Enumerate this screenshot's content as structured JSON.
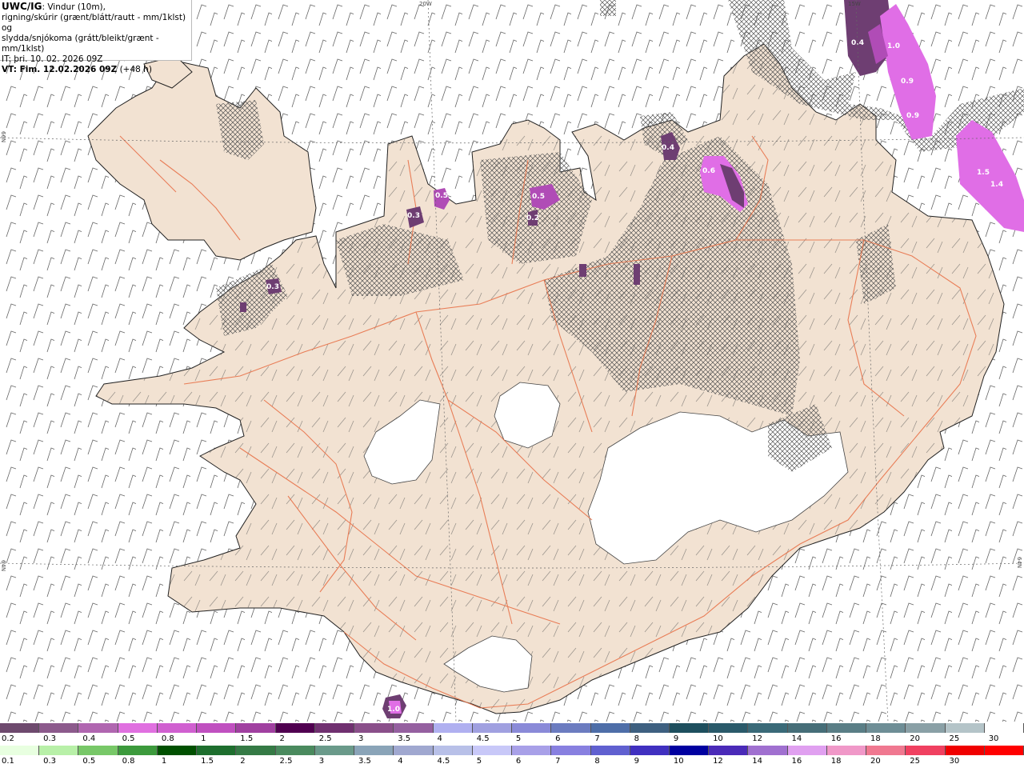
{
  "info": {
    "model": "UWC/IG",
    "line1": ": Vindur (10m),",
    "line2": "rigning/skúrir (grænt/blátt/rautt - mm/1klst) og",
    "line3": "slydda/snjókoma (grátt/bleikt/grænt - mm/1klst)",
    "line4": "IT: þri. 10. 02. 2026 09Z",
    "line5_bold": "VT: Fim. 12.02.2026 09Z",
    "line5_rest": " (+48 h)"
  },
  "grid_labels": {
    "top_20w": "20W",
    "top_15w": "15W",
    "left_66n": "66N",
    "left_64n": "64N",
    "right_64n": "64N"
  },
  "precip_labels": [
    "0.4",
    "1.0",
    "0.9",
    "0.9",
    "1.5",
    "1.4",
    "0.4",
    "0.6",
    "0.5",
    "0.3",
    "0.5",
    "0.2",
    "0.3",
    "1.0"
  ],
  "legend_snow": {
    "labels": [
      "0.2",
      "0.3",
      "0.4",
      "0.5",
      "0.8",
      "1",
      "1.5",
      "2",
      "2.5",
      "3",
      "3.5",
      "4",
      "4.5",
      "5",
      "6",
      "7",
      "8",
      "9",
      "10",
      "12",
      "14",
      "16",
      "18",
      "20",
      "25",
      "30"
    ],
    "colors": [
      "#6e4a6e",
      "#8c5a8c",
      "#b066b0",
      "#e070e0",
      "#d060d0",
      "#c050c0",
      "#a040a0",
      "#500050",
      "#703070",
      "#8a4f8a",
      "#9560a0",
      "#b0b0f0",
      "#a0a0e0",
      "#8a8ad8",
      "#6c7cc0",
      "#4e6ea8",
      "#3e6080",
      "#1e4f5e",
      "#2a5a6a",
      "#3a6a78",
      "#466e78",
      "#5a7e86",
      "#6e8e96",
      "#8aa0a6",
      "#b4c4c8",
      "#ffffff"
    ]
  },
  "legend_rain": {
    "labels": [
      "0.1",
      "0.3",
      "0.5",
      "0.8",
      "1",
      "1.5",
      "2",
      "2.5",
      "3",
      "3.5",
      "4",
      "4.5",
      "5",
      "6",
      "7",
      "8",
      "9",
      "10",
      "12",
      "14",
      "16",
      "18",
      "20",
      "25",
      "30"
    ],
    "colors": [
      "#e8ffe0",
      "#b8f0a8",
      "#78c868",
      "#3c9a3c",
      "#005000",
      "#1e6e2e",
      "#357a45",
      "#4a8a5e",
      "#6a9a8a",
      "#8aa4b8",
      "#a0a8d0",
      "#b8c0e8",
      "#c8c8f8",
      "#a8a0e8",
      "#8880e0",
      "#6060d0",
      "#4030c0",
      "#0000a0",
      "#4a2ab8",
      "#a070d0",
      "#e0a0f0",
      "#f098c8",
      "#f07890",
      "#f04060",
      "#f00000",
      "#ff0000"
    ]
  }
}
